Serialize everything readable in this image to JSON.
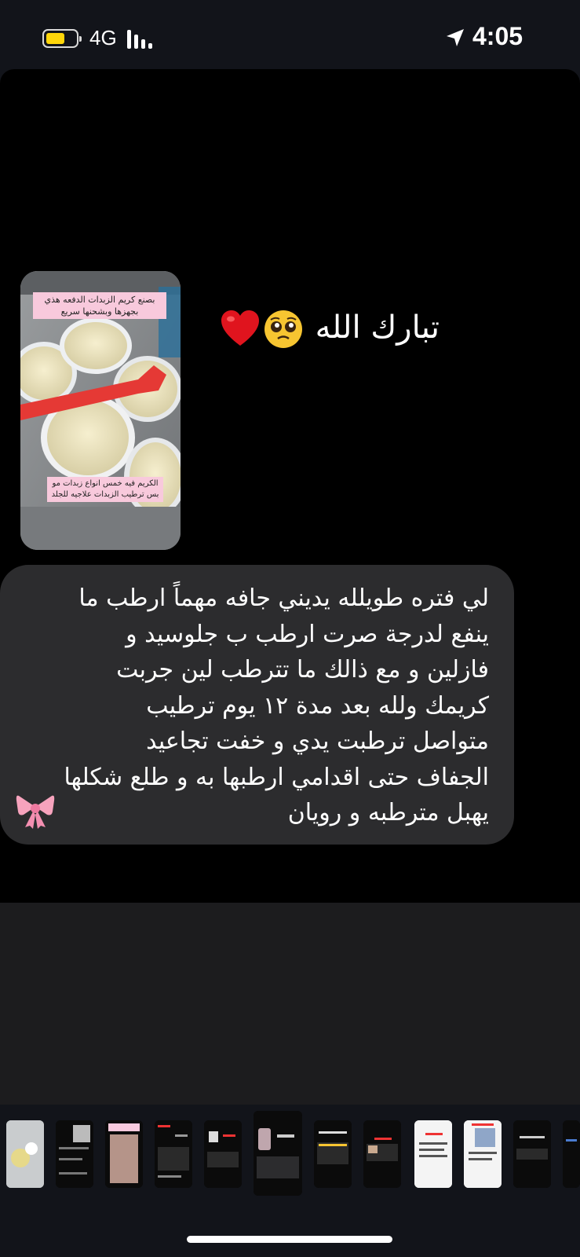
{
  "status_bar": {
    "network": "4G",
    "time": "4:05",
    "battery_level": 0.65,
    "battery_color": "#ffd60a",
    "signal_bars": 4
  },
  "post": {
    "heading": "تبارك الله",
    "heading_emojis": [
      "pleading-face-icon",
      "red-heart-icon"
    ],
    "image_caption_top": "بصنع كريم الزبدات الدفعه هذي بجهزها وبشحنها سريع",
    "image_caption_bottom": "الكريم فيه خمس انواع زبدات مو بس ترطيب الزبدات علاجيه للجلد",
    "message_lines": [
      "لي فتره طويلله يديني جافه مهماً ارطب ما",
      "ينفع لدرجة صرت ارطب ب جلوسيد و",
      "فازلين و مع ذالك ما تترطب لين جربت",
      "كريمك ولله بعد مدة ١٢ يوم ترطيب",
      "متواصل ترطبت يدي و خفت تجاعيد",
      "الجفاف حتى اقدامي ارطبها به و طلع شكلها",
      "يهبل مترطبه و رويان"
    ],
    "message_end_emoji": "ribbon-icon"
  },
  "thumbnail_strip": {
    "count": 12,
    "selected_index": 5
  },
  "colors": {
    "background": "#12141a",
    "bubble": "#2c2c2e",
    "caption_pink": "#f8c9dc"
  }
}
